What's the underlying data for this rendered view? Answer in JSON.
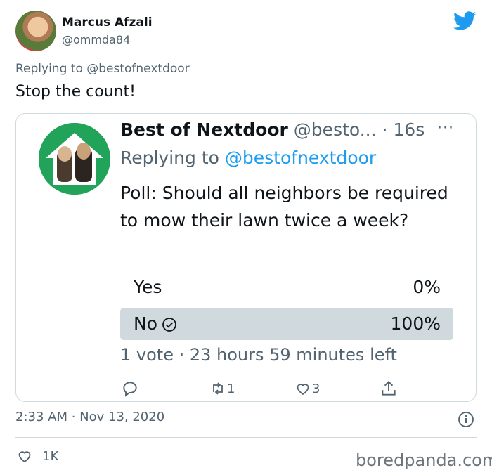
{
  "tweet": {
    "name": "Marcus Afzali",
    "handle": "@ommda84",
    "reply_prefix": "Replying to @bestofnextdoor",
    "text": "Stop the count!",
    "timestamp": "2:33 AM · Nov 13, 2020",
    "likes": "1K"
  },
  "quoted": {
    "name": "Best of Nextdoor",
    "handle_time": " @besto... · 16s",
    "more": "···",
    "reply_prefix": "Replying to ",
    "reply_handle": "@bestofnextdoor",
    "text": "Poll: Should all neighbors be required to mow their lawn twice a week?",
    "poll": {
      "options": [
        {
          "label": "Yes",
          "percent": "0%"
        },
        {
          "label": "No",
          "percent": "100%"
        }
      ],
      "meta": "1 vote · 23 hours 59 minutes left"
    },
    "actions": {
      "retweets": "1",
      "likes": "3"
    }
  },
  "watermark": "boredpanda.com",
  "colors": {
    "twitter_blue": "#1d9bf0",
    "secondary_text": "#536471",
    "border": "#cfd9de",
    "poll_winner": "#cfd9de",
    "avatar_green": "#21a35a"
  },
  "icons": [
    "twitter-bird-icon",
    "reply-icon",
    "retweet-icon",
    "heart-icon",
    "share-icon",
    "info-icon",
    "check-circle-icon"
  ]
}
